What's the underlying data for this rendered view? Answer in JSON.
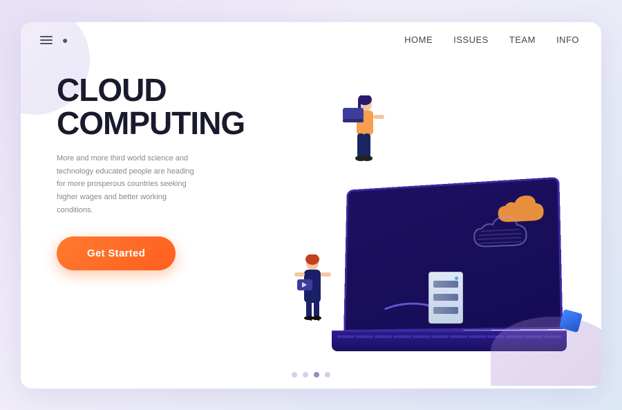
{
  "nav": {
    "menu_icon": "≡",
    "search_icon": "🔍",
    "links": [
      {
        "label": "HOME",
        "id": "home"
      },
      {
        "label": "ISSUES",
        "id": "issues"
      },
      {
        "label": "TEAM",
        "id": "team"
      },
      {
        "label": "INFO",
        "id": "info"
      }
    ]
  },
  "hero": {
    "title_line1": "CLOUD",
    "title_line2": "COMPUTING",
    "description": "More and more third world science and technology educated people are heading for more prosperous countries seeking higher wages and better working conditions.",
    "cta_label": "Get Started"
  },
  "pagination": {
    "dots": [
      false,
      false,
      true,
      false
    ]
  },
  "colors": {
    "accent_orange": "#ff7a2f",
    "brand_purple": "#3d2aa0",
    "laptop_dark": "#1a0f6b"
  }
}
